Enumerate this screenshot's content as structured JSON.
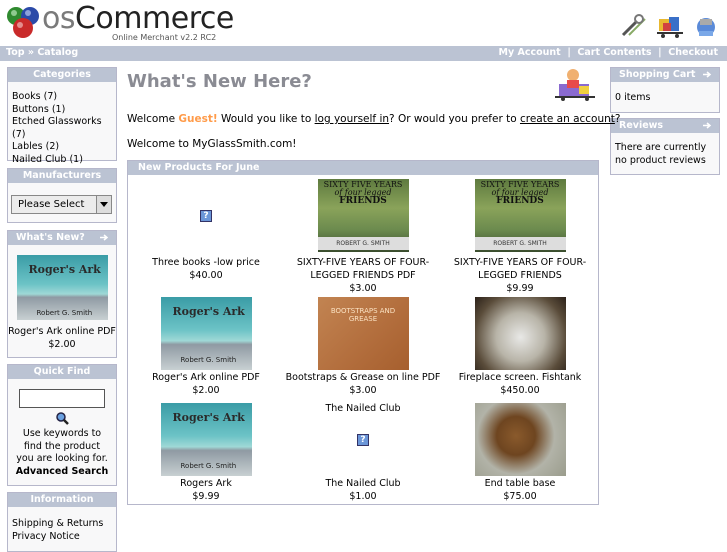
{
  "header": {
    "logo_os": "os",
    "logo_commerce": "Commerce",
    "logo_sub": "Online Merchant v2.2 RC2",
    "icons": [
      "tools-icon",
      "cart-boxes-icon",
      "cash-register-icon"
    ]
  },
  "nav": {
    "top": "Top",
    "sep": "»",
    "catalog": "Catalog",
    "my_account": "My Account",
    "cart_contents": "Cart Contents",
    "checkout": "Checkout",
    "divider": "|"
  },
  "categories": {
    "title": "Categories",
    "items": [
      {
        "label": "Books",
        "count": "(7)"
      },
      {
        "label": "Buttons",
        "count": "(1)"
      },
      {
        "label": "Etched Glassworks",
        "count": "(7)"
      },
      {
        "label": "Lables",
        "count": "(2)"
      },
      {
        "label": "Nailed Club",
        "count": "(1)"
      }
    ]
  },
  "manufacturers": {
    "title": "Manufacturers",
    "select_value": "Please Select"
  },
  "whats_new": {
    "title": "What's New?",
    "img_title": "Roger's Ark",
    "img_author": "Robert G. Smith",
    "name": "Roger's Ark online PDF",
    "price": "$2.00"
  },
  "quick_find": {
    "title": "Quick Find",
    "input_value": "",
    "help": "Use keywords to find the product you are looking for.",
    "advanced": "Advanced Search"
  },
  "information": {
    "title": "Information",
    "items": [
      "Shipping & Returns",
      "Privacy Notice"
    ]
  },
  "shopping_cart": {
    "title": "Shopping Cart",
    "content": "0 items"
  },
  "reviews": {
    "title": "Reviews",
    "content": "There are currently no product reviews"
  },
  "main": {
    "title": "What's New Here?",
    "welcome_pre": "Welcome ",
    "guest": "Guest!",
    "welcome_mid": " Would you like to ",
    "login_link": "log yourself in",
    "welcome_mid2": "? Or would you prefer to ",
    "create_link": "create an account",
    "welcome_end": "?",
    "site_welcome": "Welcome to MyGlassSmith.com!"
  },
  "new_products": {
    "title": "New Products For June",
    "items": [
      {
        "name": "Three books -low price",
        "price": "$40.00",
        "img": "missing"
      },
      {
        "name": "SIXTY-FIVE YEARS OF FOUR-LEGGED FRIENDS PDF",
        "price": "$3.00",
        "img": "book"
      },
      {
        "name": "SIXTY-FIVE YEARS OF FOUR-LEGGED FRIENDS",
        "price": "$9.99",
        "img": "book"
      },
      {
        "name": "Roger's Ark online PDF",
        "price": "$2.00",
        "img": "sea"
      },
      {
        "name": "Bootstraps & Grease on line PDF",
        "price": "$3.00",
        "img": "bootstrap"
      },
      {
        "name": "Fireplace screen. Fishtank",
        "price": "$450.00",
        "img": "fireplace"
      },
      {
        "name": "Rogers Ark",
        "price": "$9.99",
        "img": "sea"
      },
      {
        "name": "The Nailed Club",
        "price": "$1.00",
        "img": "missing",
        "caption_above": "The Nailed Club"
      },
      {
        "name": "End table base",
        "price": "$75.00",
        "img": "endtable"
      }
    ],
    "book_title_top": "SIXTY FIVE YEARS",
    "book_title_mid": "of four legged",
    "book_title_big": "FRIENDS",
    "book_author": "ROBERT G. SMITH",
    "bootstrap_text": "BOOTSTRAPS AND GREASE",
    "missing_glyph": "?"
  }
}
